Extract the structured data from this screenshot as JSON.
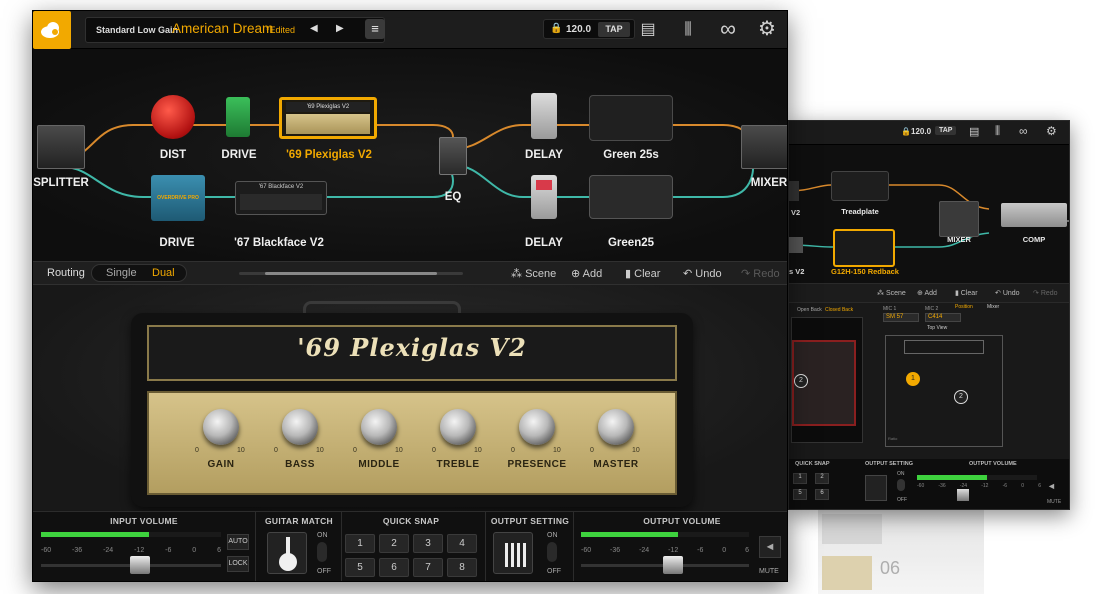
{
  "main": {
    "topbar": {
      "preset_bank": "Standard Low Gain",
      "preset_name": "American Dream",
      "edited_tag": "*Edited",
      "tempo": "120.0",
      "tap": "TAP"
    },
    "chain": {
      "splitter": "SPLITTER",
      "mixer": "MIXER",
      "eq": "EQ",
      "top_path": [
        {
          "label": "DIST"
        },
        {
          "label": "DRIVE"
        },
        {
          "label": "'69 Plexiglas V2",
          "selected": true
        },
        {
          "label": "DELAY"
        },
        {
          "label": "Green 25s"
        }
      ],
      "bottom_path": [
        {
          "label": "DRIVE"
        },
        {
          "label": "'67 Blackface V2"
        },
        {
          "label": "DELAY"
        },
        {
          "label": "Green25"
        }
      ],
      "amp_plate_top": "'69 Plexiglas V2",
      "amp_plate_bottom": "'67 Blackface V2",
      "pedal_text_overdrive": "OVERDRIVE PRO"
    },
    "toolbar": {
      "routing_label": "Routing",
      "single": "Single",
      "dual": "Dual",
      "active_routing": "Dual",
      "scene": "Scene",
      "add": "Add",
      "clear": "Clear",
      "undo": "Undo",
      "redo": "Redo"
    },
    "amp": {
      "name": "'69 Plexiglas V2",
      "knobs": [
        "GAIN",
        "BASS",
        "MIDDLE",
        "TREBLE",
        "PRESENCE",
        "MASTER"
      ],
      "scale_min": "0",
      "scale_max": "10"
    },
    "bottom": {
      "input_volume": "INPUT VOLUME",
      "guitar_match": "GUITAR MATCH",
      "quick_snap": "QUICK SNAP",
      "output_setting": "OUTPUT SETTING",
      "output_volume": "OUTPUT VOLUME",
      "auto": "AUTO",
      "lock": "LOCK",
      "on": "ON",
      "off": "OFF",
      "mute": "MUTE",
      "snaps": [
        "1",
        "2",
        "3",
        "4",
        "5",
        "6",
        "7",
        "8"
      ],
      "meter_scale": [
        "-60",
        "-36",
        "-24",
        "-12",
        "-6",
        "0",
        "6"
      ]
    }
  },
  "secondary": {
    "topbar": {
      "tempo": "120.0",
      "tap": "TAP"
    },
    "chain": {
      "top_labels": [
        "V2",
        "Treadplate"
      ],
      "mixer": "MIXER",
      "comp": "COMP",
      "bottom_labels": [
        "s V2",
        "G12H-150 Redback"
      ]
    },
    "toolbar": {
      "scene": "Scene",
      "add": "Add",
      "clear": "Clear",
      "undo": "Undo",
      "redo": "Redo"
    },
    "cab": {
      "open_back": "Open Back",
      "closed_back": "Closed Back",
      "mic1_label": "MIC 1",
      "mic2_label": "MIC 2",
      "mic1": "SM 57",
      "mic2": "C414",
      "position": "Position",
      "mixer": "Mixer",
      "top_view": "Top View",
      "mic_badge_1": "1",
      "mic_badge_2": "2",
      "ratio": "Ratio"
    },
    "bottom": {
      "quick_snap": "QUICK SNAP",
      "output_setting": "OUTPUT SETTING",
      "output_volume": "OUTPUT VOLUME",
      "snaps": [
        "1",
        "2",
        "5",
        "6"
      ],
      "on": "ON",
      "off": "OFF",
      "mute": "MUTE",
      "meter_scale": [
        "-60",
        "-36",
        "-24",
        "-12",
        "-6",
        "0",
        "6"
      ]
    }
  },
  "ghost": {
    "number": "06"
  },
  "colors": {
    "accent": "#f2a900",
    "top_cable": "#d8892c",
    "bottom_cable": "#3fb8a8",
    "amp_panel": "#c9b47a",
    "meter_green": "#3ed23e"
  },
  "levels": {
    "input_meter": 0.6,
    "output_meter": 0.58,
    "input_fader": 0.55,
    "output_fader": 0.55
  }
}
